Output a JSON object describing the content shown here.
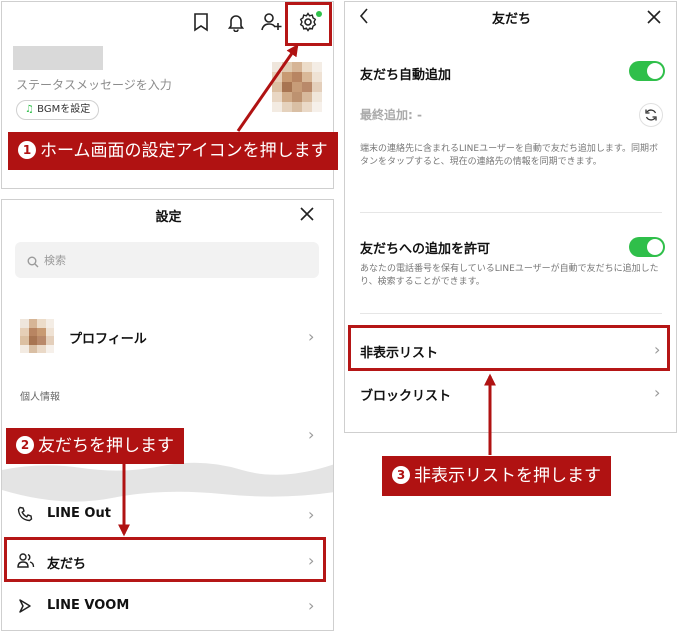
{
  "home": {
    "status_placeholder": "ステータスメッセージを入力",
    "bgm_label": "BGMを設定"
  },
  "settings": {
    "title": "設定",
    "search_placeholder": "検索",
    "profile_label": "プロフィール",
    "section_personal": "個人情報",
    "items": [
      "LINE Out",
      "友だち",
      "LINE VOOM"
    ]
  },
  "friends": {
    "title": "友だち",
    "auto_add_label": "友だち自動追加",
    "last_added_label": "最終追加: -",
    "auto_add_desc": "端末の連絡先に含まれるLINEユーザーを自動で友だち追加します。同期ボタンをタップすると、現在の連絡先の情報を同期できます。",
    "allow_add_label": "友だちへの追加を許可",
    "allow_add_desc": "あなたの電話番号を保有しているLINEユーザーが自動で友だちに追加したり、検索することができます。",
    "hidden_list": "非表示リスト",
    "block_list": "ブロックリスト"
  },
  "callouts": {
    "c1_num": "1",
    "c1": "ホーム画面の設定アイコンを押します",
    "c2_num": "2",
    "c2": "友だちを押します",
    "c3_num": "3",
    "c3": "非表示リストを押します"
  },
  "colors": {
    "accent_red": "#b01212",
    "toggle_green": "#2fbf4a"
  }
}
